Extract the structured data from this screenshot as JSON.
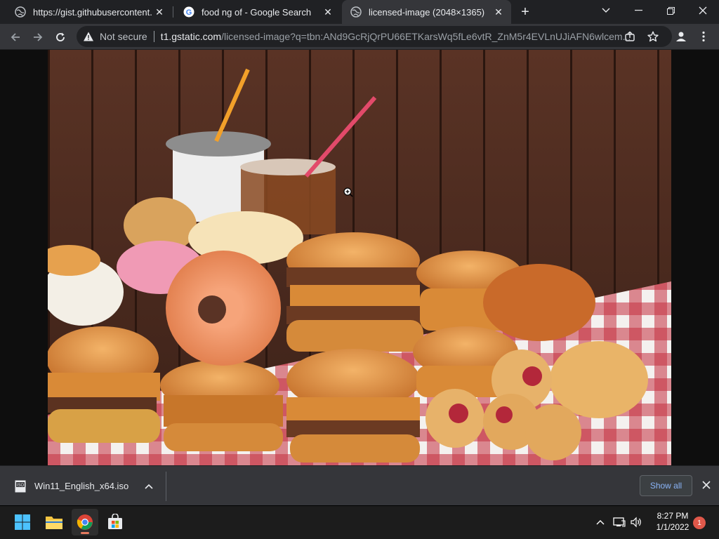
{
  "tabs": [
    {
      "title": "https://gist.githubusercontent.com",
      "favicon": "globe-icon",
      "active": false
    },
    {
      "title": "food ng of - Google Search",
      "favicon": "google-icon",
      "active": false
    },
    {
      "title": "licensed-image (2048×1365)",
      "favicon": "globe-icon",
      "active": true
    }
  ],
  "omnibox": {
    "security_label": "Not secure",
    "host": "t1.gstatic.com",
    "path": "/licensed-image?q=tbn:ANd9GcRjQrPU66ETKarsWq5fLe6vtR_ZnM5r4EVLnUJiAFN6wlcem..."
  },
  "downloads": {
    "item_name": "Win11_English_x64.iso",
    "show_all_label": "Show all"
  },
  "taskbar": {
    "time": "8:27 PM",
    "date": "1/1/2022",
    "notification_count": "1"
  },
  "colors": {
    "accent_link": "#8ab4f8",
    "tab_bg": "#202124",
    "toolbar_bg": "#35363a",
    "taskbar_bg": "#1c1c1c",
    "badge": "#e0584a"
  }
}
